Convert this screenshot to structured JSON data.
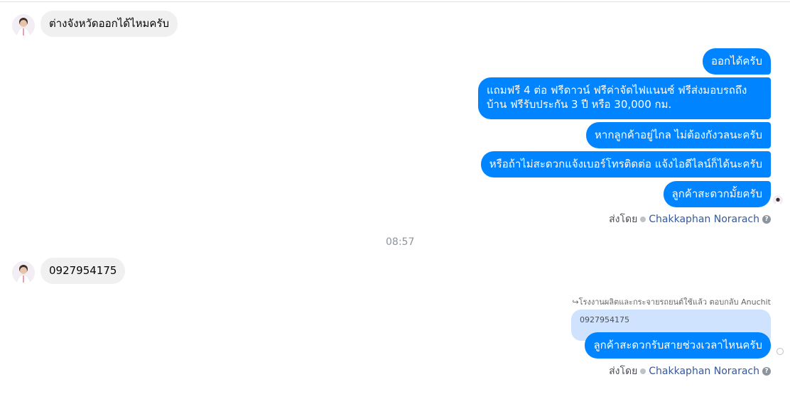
{
  "messages": {
    "incoming_1": "ต่างจังหวัดออกได้ไหมครับ",
    "out_1": "ออกได้ครับ",
    "out_2": "แถมฟรี 4 ต่อ ฟรีดาวน์ ฟรีค่าจัดไฟแนนซ์ ฟรีส่งมอบรถถึงบ้าน ฟรีรับประกัน 3 ปี หรือ 30,000 กม.",
    "out_3": "หากลูกค้าอยู่ไกล ไม่ต้องกังวลนะครับ",
    "out_4": "หรือถ้าไม่สะดวกแจ้งเบอร์โทรติดต่อ แจ้งไอดีไลน์ก็ได้นะครับ",
    "out_5": "ลูกค้าสะดวกมั้ยครับ",
    "timestamp": "08:57",
    "incoming_2": "0927954175",
    "reply_meta": "โรงงานผลิตและกระจายรถยนต์ใช้แล้ว ตอบกลับ Anuchit",
    "reply_quote": "0927954175",
    "out_6": "ลูกค้าสะดวกรับสายช่วงเวลาไหนครับ"
  },
  "sent_by": {
    "label": "ส่งโดย",
    "name": "Chakkaphan Norarach",
    "help": "?"
  },
  "colors": {
    "outgoing_bubble": "#0084ff",
    "incoming_bubble": "#f0f0f0",
    "reply_quote": "#cfe3ff",
    "sender_name": "#385898"
  },
  "icons": {
    "avatar": "person-avatar-icon",
    "sent_check": "check-circle-icon",
    "help": "question-circle-icon",
    "reply": "reply-arrow-icon"
  }
}
